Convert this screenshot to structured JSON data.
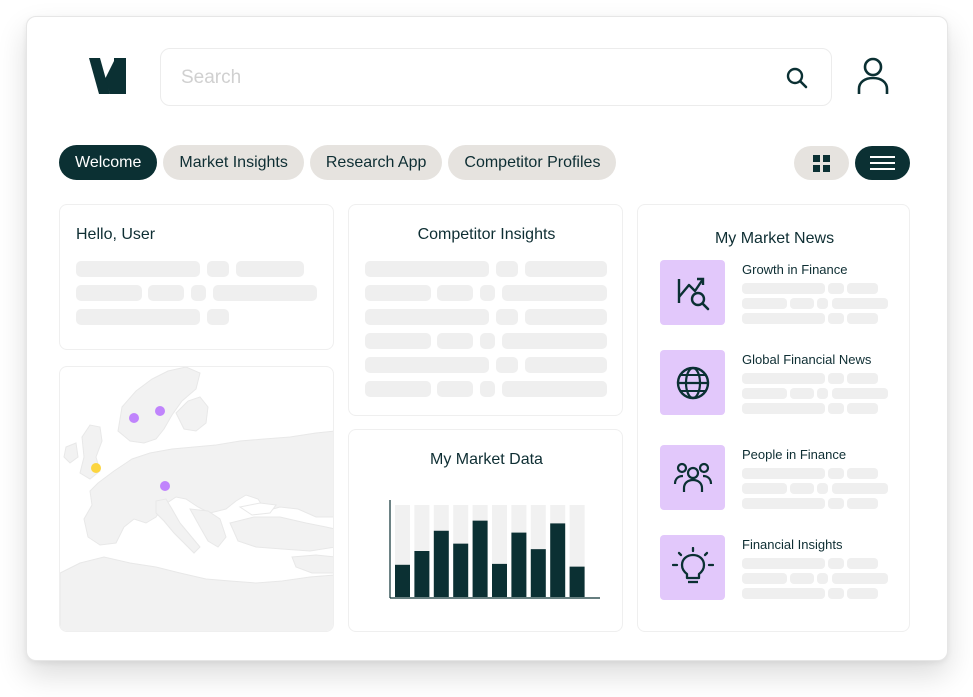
{
  "search": {
    "placeholder": "Search"
  },
  "tabs": [
    {
      "label": "Welcome",
      "active": true
    },
    {
      "label": "Market Insights",
      "active": false
    },
    {
      "label": "Research App",
      "active": false
    },
    {
      "label": "Competitor Profiles",
      "active": false
    }
  ],
  "view_toggle": {
    "options": [
      "grid-icon",
      "list-icon"
    ],
    "selected": "list-icon"
  },
  "greeting": {
    "title": "Hello, User"
  },
  "competitor_insights": {
    "title": "Competitor Insights"
  },
  "market_data": {
    "title": "My Market Data",
    "chart_data": {
      "type": "bar",
      "values": [
        35,
        50,
        72,
        58,
        83,
        36,
        70,
        52,
        80,
        33
      ],
      "background_values": [
        100,
        100,
        100,
        100,
        100,
        100,
        100,
        100,
        100,
        100
      ],
      "ylim": [
        0,
        100
      ],
      "bar_color": "#0b3033",
      "background_color": "#f1f1f1"
    }
  },
  "news": {
    "title": "My Market News",
    "items": [
      {
        "title": "Growth in Finance",
        "icon": "chart-search-icon"
      },
      {
        "title": "Global Financial News",
        "icon": "globe-icon"
      },
      {
        "title": "People in Finance",
        "icon": "people-icon"
      },
      {
        "title": "Financial Insights",
        "icon": "lightbulb-icon"
      }
    ]
  },
  "colors": {
    "brand": "#0b3033",
    "chip": "#e6e3df",
    "news_icon_bg": "#e2c8fb",
    "map_dot_purple": "#c084fc",
    "map_dot_yellow": "#fcd53f"
  }
}
